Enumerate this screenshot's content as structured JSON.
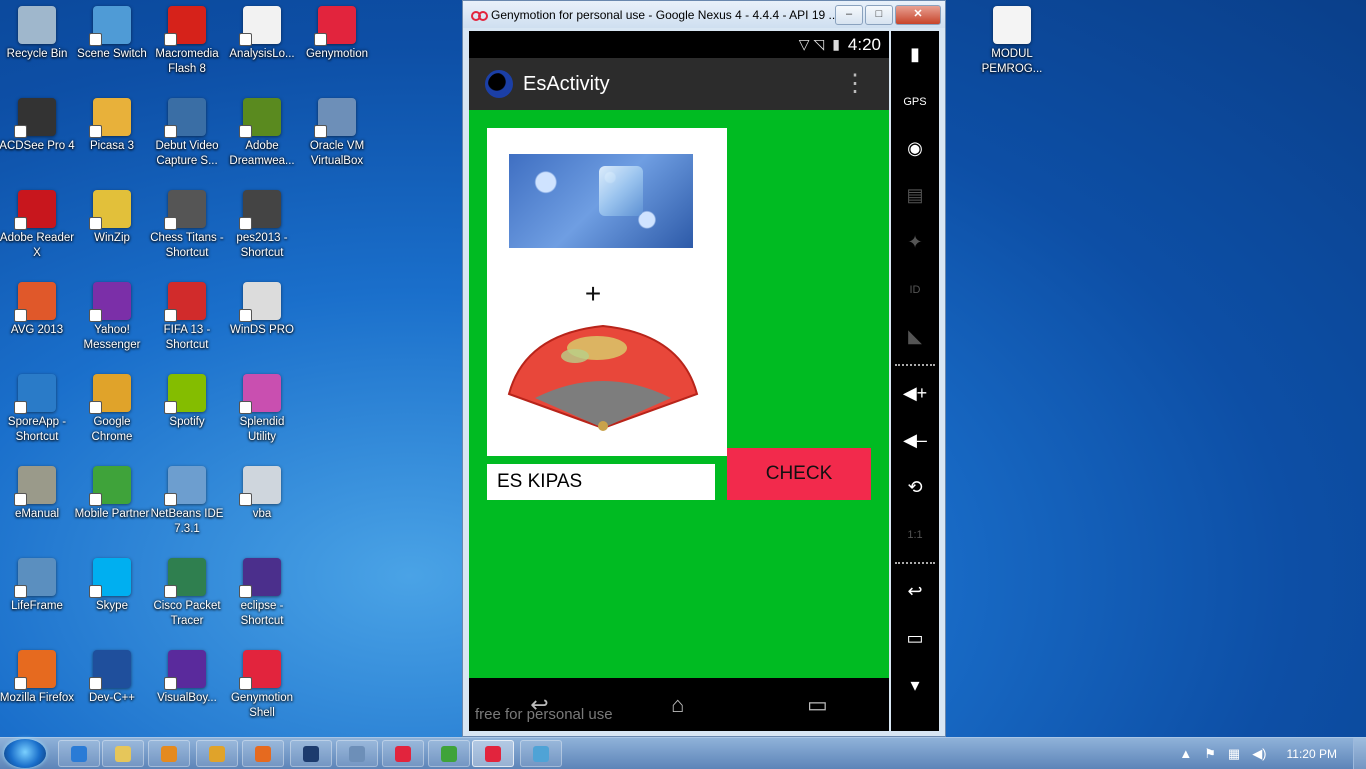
{
  "desktop": {
    "icons": [
      {
        "label": "Recycle Bin",
        "icon": "recycle-bin-icon",
        "color": "#9fb7cc"
      },
      {
        "label": "Scene Switch",
        "icon": "scene-switch-icon",
        "color": "#4f9bd6"
      },
      {
        "label": "Macromedia Flash 8",
        "icon": "flash-icon",
        "color": "#d6221a"
      },
      {
        "label": "AnalysisLo...",
        "icon": "document-icon",
        "color": "#f2f2f2"
      },
      {
        "label": "Genymotion",
        "icon": "genymotion-icon",
        "color": "#e2243d"
      },
      {
        "label": "ACDSee Pro 4",
        "icon": "camera-icon",
        "color": "#333333"
      },
      {
        "label": "Picasa 3",
        "icon": "picasa-icon",
        "color": "#e8b13a"
      },
      {
        "label": "Debut Video Capture S...",
        "icon": "video-capture-icon",
        "color": "#3a6ea5"
      },
      {
        "label": "Adobe Dreamwea...",
        "icon": "dreamweaver-icon",
        "color": "#5a8a1f"
      },
      {
        "label": "Oracle VM VirtualBox",
        "icon": "virtualbox-icon",
        "color": "#6d8fb8"
      },
      {
        "label": "Adobe Reader X",
        "icon": "pdf-icon",
        "color": "#c8161d"
      },
      {
        "label": "WinZip",
        "icon": "winzip-icon",
        "color": "#e2c03a"
      },
      {
        "label": "Chess Titans - Shortcut",
        "icon": "chess-icon",
        "color": "#555555"
      },
      {
        "label": "pes2013 - Shortcut",
        "icon": "pes-icon",
        "color": "#444444"
      },
      {
        "label": "AVG 2013",
        "icon": "avg-icon",
        "color": "#e0582a"
      },
      {
        "label": "Yahoo! Messenger",
        "icon": "yahoo-icon",
        "color": "#7b2fa8"
      },
      {
        "label": "FIFA 13 - Shortcut",
        "icon": "fifa-icon",
        "color": "#d12b2b"
      },
      {
        "label": "WinDS PRO",
        "icon": "ds-icon",
        "color": "#dcdcdc"
      },
      {
        "label": "SporeApp - Shortcut",
        "icon": "spore-icon",
        "color": "#2a7bc8"
      },
      {
        "label": "Google Chrome",
        "icon": "chrome-icon",
        "color": "#e0a32a"
      },
      {
        "label": "Spotify",
        "icon": "spotify-icon",
        "color": "#84bd00"
      },
      {
        "label": "Splendid Utility",
        "icon": "splendid-icon",
        "color": "#c94fb0"
      },
      {
        "label": "eManual",
        "icon": "manual-icon",
        "color": "#9a9a8a"
      },
      {
        "label": "Mobile Partner",
        "icon": "mobile-partner-icon",
        "color": "#3fa33a"
      },
      {
        "label": "NetBeans IDE 7.3.1",
        "icon": "netbeans-icon",
        "color": "#6d9ecf"
      },
      {
        "label": "vba",
        "icon": "settings-file-icon",
        "color": "#cfd6dd"
      },
      {
        "label": "LifeFrame",
        "icon": "lifeframe-icon",
        "color": "#5b8fbf"
      },
      {
        "label": "Skype",
        "icon": "skype-icon",
        "color": "#00aff0"
      },
      {
        "label": "Cisco Packet Tracer",
        "icon": "cisco-icon",
        "color": "#2f7f4f"
      },
      {
        "label": "eclipse - Shortcut",
        "icon": "eclipse-icon",
        "color": "#4b2f8c"
      },
      {
        "label": "Mozilla Firefox",
        "icon": "firefox-icon",
        "color": "#e66a1f"
      },
      {
        "label": "Dev-C++",
        "icon": "devcpp-icon",
        "color": "#1f4f9c"
      },
      {
        "label": "VisualBoy...",
        "icon": "gameboy-icon",
        "color": "#5a2a9c"
      },
      {
        "label": "Genymotion Shell",
        "icon": "genymotion-shell-icon",
        "color": "#e2243d"
      },
      {
        "label": "MODUL PEMROG...",
        "icon": "pdf-file-icon",
        "color": "#f4f4f4"
      }
    ]
  },
  "window": {
    "title": "Genymotion for personal use - Google Nexus 4 - 4.4.4 - API 19 ...",
    "minimize": "–",
    "maximize": "□",
    "close": "✕"
  },
  "phone": {
    "status_time": "4:20",
    "status_icons": "▽ ◹",
    "app_title": "EsActivity",
    "overflow": "⋮",
    "plus": "+",
    "answer_value": "ES KIPAS",
    "check_label": "CHECK",
    "watermark": "free for personal use",
    "nav_back": "↩",
    "nav_home": "⌂",
    "nav_recent": "▭"
  },
  "side_panel": [
    {
      "name": "battery-button",
      "glyph": "▮",
      "dim": false
    },
    {
      "name": "gps-button",
      "glyph": "GPS",
      "dim": false
    },
    {
      "name": "webcam-button",
      "glyph": "◉",
      "dim": false
    },
    {
      "name": "screencast-button",
      "glyph": "▤",
      "dim": true
    },
    {
      "name": "dpad-button",
      "glyph": "✦",
      "dim": true
    },
    {
      "name": "device-id-button",
      "glyph": "ID",
      "dim": true
    },
    {
      "name": "network-button",
      "glyph": "◣",
      "dim": true
    },
    {
      "name": "volume-up-button",
      "glyph": "◀+",
      "dim": false
    },
    {
      "name": "volume-down-button",
      "glyph": "◀–",
      "dim": false
    },
    {
      "name": "rotate-button",
      "glyph": "⟲",
      "dim": false
    },
    {
      "name": "pixel-perfect-button",
      "glyph": "1:1",
      "dim": true
    },
    {
      "name": "back-button",
      "glyph": "↩",
      "dim": false
    },
    {
      "name": "recent-apps-button",
      "glyph": "▭",
      "dim": false
    },
    {
      "name": "scroll-down-button",
      "glyph": "▾",
      "dim": false
    }
  ],
  "taskbar": {
    "items": [
      {
        "name": "taskbar-ie",
        "color": "#2a7bd6"
      },
      {
        "name": "taskbar-explorer",
        "color": "#e6c65a"
      },
      {
        "name": "taskbar-media-player",
        "color": "#e58a1f"
      },
      {
        "name": "taskbar-chrome",
        "color": "#e0a32a"
      },
      {
        "name": "taskbar-firefox",
        "color": "#e66a1f"
      },
      {
        "name": "taskbar-photoshop",
        "color": "#1c3b6e"
      },
      {
        "name": "taskbar-virtualbox",
        "color": "#6d8fb8"
      },
      {
        "name": "taskbar-genymotion",
        "color": "#e2243d"
      },
      {
        "name": "taskbar-app-green",
        "color": "#3fa33a"
      },
      {
        "name": "taskbar-genymotion-active",
        "color": "#e2243d"
      },
      {
        "name": "taskbar-paint",
        "color": "#4fa3d6"
      }
    ],
    "tray_up": "▲",
    "tray_flag": "⚑",
    "tray_net": "▦",
    "tray_vol": "◀)",
    "clock": "11:20 PM"
  }
}
